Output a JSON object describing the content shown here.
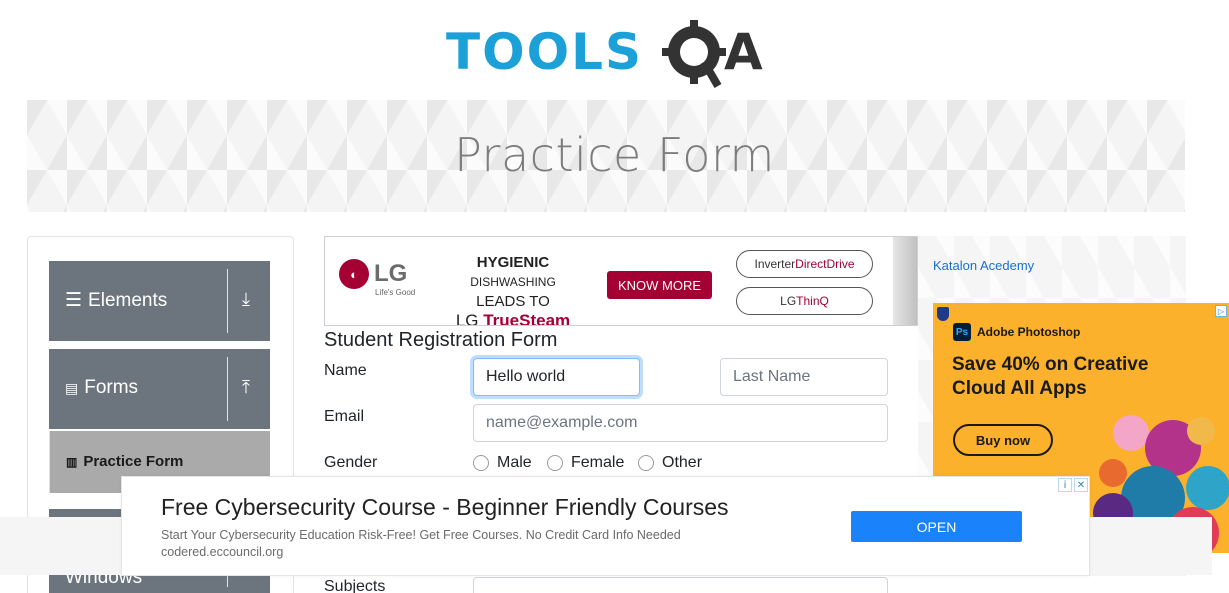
{
  "header": {
    "logo_text": "TOOLSQA"
  },
  "banner": {
    "title": "Practice Form"
  },
  "sidebar": {
    "groups": [
      {
        "label": "Elements",
        "icon": "hamburger-icon",
        "arrow": "download-arrow-icon"
      },
      {
        "label": "Forms",
        "icon": "document-icon",
        "arrow": "upload-arrow-icon"
      },
      {
        "label": "Windows",
        "icon": "",
        "arrow": ""
      }
    ],
    "active_item": {
      "label": "Practice Form",
      "icon": "form-icon"
    }
  },
  "lg_ad": {
    "brand": "LG",
    "tagline": "Life's Good",
    "headline_1a": "HYGIENIC ",
    "headline_1b": "DISHWASHING",
    "headline_2": "LEADS TO",
    "headline_3a": "LG ",
    "headline_3b": "TrueSteam",
    "cta": "KNOW MORE",
    "pill1a": "Inverter ",
    "pill1b": "DirectDrive",
    "pill2a": "LG ",
    "pill2b": "ThinQ",
    "accent_color": "#a50034"
  },
  "form": {
    "title": "Student Registration Form",
    "name_label": "Name",
    "first_name_value": "Hello world",
    "last_name_placeholder": "Last Name",
    "email_label": "Email",
    "email_placeholder": "name@example.com",
    "gender_label": "Gender",
    "gender_options": [
      "Male",
      "Female",
      "Other"
    ],
    "subjects_label": "Subjects"
  },
  "right_ads": {
    "katalon_link": "Katalon Acedemy",
    "adobe": {
      "product": "Adobe Photoshop",
      "headline": "Save 40% on Creative Cloud All Apps",
      "cta": "Buy now",
      "bg_color": "#fbb12b"
    }
  },
  "bottom_ad": {
    "title": "Free Cybersecurity Course - Beginner Friendly Courses",
    "description": "Start Your Cybersecurity Education Risk-Free! Get Free Courses. No Credit Card Info Needed",
    "url": "codered.eccouncil.org",
    "cta": "OPEN",
    "cta_color": "#1a82fb"
  }
}
